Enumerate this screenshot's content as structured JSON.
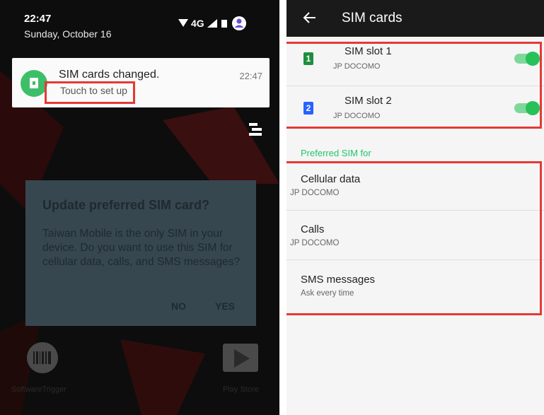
{
  "left_phone": {
    "status": {
      "time": "22:47",
      "date": "Sunday, October 16",
      "network": "4G"
    },
    "notification": {
      "title": "SIM cards changed.",
      "time": "22:47",
      "subtitle": "Touch to set up"
    },
    "dialog": {
      "title": "Update preferred SIM card?",
      "body": "Taiwan Mobile is the only SIM in your device. Do you want to use this SIM for cellular data, calls, and SMS messages?",
      "no_label": "NO",
      "yes_label": "YES"
    },
    "apps": [
      {
        "label": "SoftwareTrigger",
        "icon": "barcode-app-icon"
      },
      {
        "label": "Play Store",
        "icon": "play-store-icon"
      }
    ]
  },
  "right_phone": {
    "title": "SIM cards",
    "sims": [
      {
        "badge": "1",
        "name": "SIM slot 1",
        "carrier": "JP DOCOMO",
        "color": "#1e8e3e",
        "enabled": true
      },
      {
        "badge": "2",
        "name": "SIM slot 2",
        "carrier": "JP DOCOMO",
        "color": "#2962ff",
        "enabled": true
      }
    ],
    "section_label": "Preferred SIM for",
    "preferences": [
      {
        "title": "Cellular data",
        "value": "JP DOCOMO"
      },
      {
        "title": "Calls",
        "value": "JP DOCOMO"
      },
      {
        "title": "SMS messages",
        "value": "Ask every time"
      }
    ]
  },
  "colors": {
    "highlight": "#e53935",
    "accent": "#21c46c"
  }
}
